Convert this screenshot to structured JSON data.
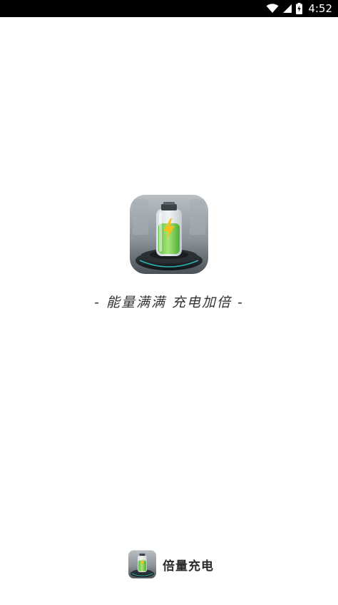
{
  "status_bar": {
    "time": "4:52",
    "icons": [
      "wifi-icon",
      "cell-signal-icon",
      "battery-charging-icon"
    ]
  },
  "splash": {
    "logo_icon": "battery-charging-logo",
    "slogan": "- 能量满满 充电加倍 -"
  },
  "footer": {
    "brand_icon": "battery-charging-logo",
    "app_name": "倍量充电"
  },
  "colors": {
    "status_bar_bg": "#000000",
    "background": "#ffffff",
    "battery_green": "#7fd35a",
    "bolt_yellow": "#f3c11b",
    "base_dark": "#1f2326",
    "accent_cyan": "#2fd6d0"
  }
}
